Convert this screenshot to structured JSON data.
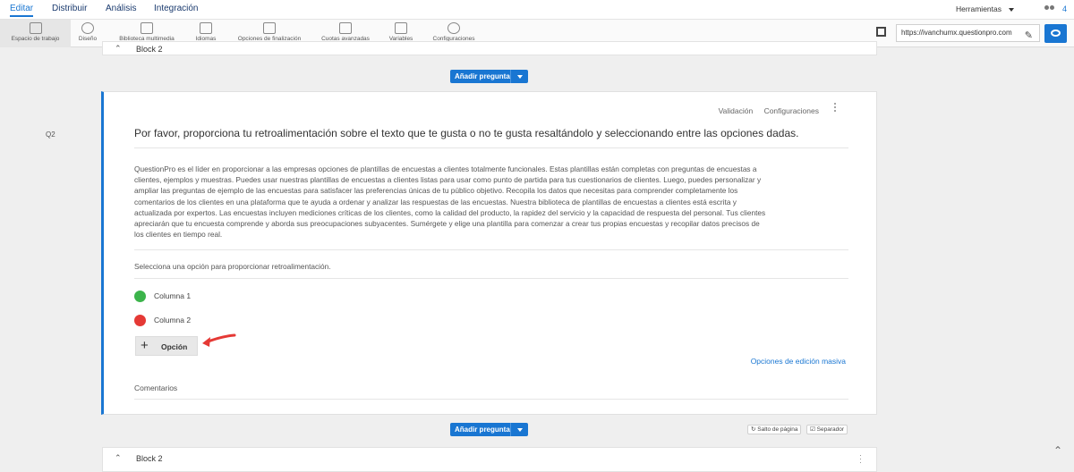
{
  "topnav": {
    "tabs": [
      "Editar",
      "Distribuir",
      "Análisis",
      "Integración"
    ],
    "tools_label": "Herramientas",
    "users_count": "4"
  },
  "toolbar": {
    "items": [
      "Espacio de trabajo",
      "Diseño",
      "Biblioteca multimedia",
      "Idiomas",
      "Opciones de finalización",
      "Cuotas avanzadas",
      "Variables",
      "Configuraciones"
    ],
    "url": "https://ivanchumx.questionpro.com"
  },
  "block_top": {
    "title": "Block 2"
  },
  "add_question_label": "Añadir pregunta",
  "question": {
    "number": "Q2",
    "validation_link": "Validación",
    "settings_link": "Configuraciones",
    "title": "Por favor, proporciona tu retroalimentación sobre el texto que te gusta o no te gusta resaltándolo y seleccionando entre las opciones dadas.",
    "body_lines": [
      "QuestionPro es el líder en proporcionar a las empresas opciones de plantillas de encuestas a clientes totalmente funcionales. Estas plantillas están completas con preguntas de encuestas a",
      "clientes, ejemplos y muestras. Puedes usar nuestras plantillas de encuestas a clientes listas para usar como punto de partida para tus cuestionarios de clientes. Luego, puedes personalizar y",
      "ampliar las preguntas de ejemplo de las encuestas para satisfacer las preferencias únicas de tu público objetivo. Recopila los datos que necesitas para comprender completamente los",
      "comentarios de los clientes en una plataforma que te ayuda a ordenar y analizar las respuestas de las encuestas. Nuestra biblioteca de plantillas de encuestas a clientes está escrita y",
      "actualizada por expertos. Las encuestas incluyen mediciones críticas de los clientes, como la calidad del producto, la rapidez del servicio y la capacidad de respuesta del personal. Tus clientes",
      "apreciarán que tu encuesta comprende y aborda sus preocupaciones subyacentes. Sumérgete y elige una plantilla para comenzar a crear tus propias encuestas y recopilar datos precisos de",
      "los clientes en tiempo real."
    ],
    "instruction": "Selecciona una opción para proporcionar retroalimentación.",
    "options": [
      {
        "label": "Columna 1",
        "color": "#3cb44b"
      },
      {
        "label": "Columna 2",
        "color": "#e53935"
      }
    ],
    "add_option_label": "Opción",
    "bulk_edit_link": "Opciones de edición masiva",
    "comments_label": "Comentarios"
  },
  "bottom_controls": {
    "page_break": "Salto de página",
    "separator": "Separador"
  },
  "block_bottom": {
    "title": "Block 2"
  },
  "colors": {
    "accent": "#1976d2",
    "arrow": "#e53935"
  }
}
